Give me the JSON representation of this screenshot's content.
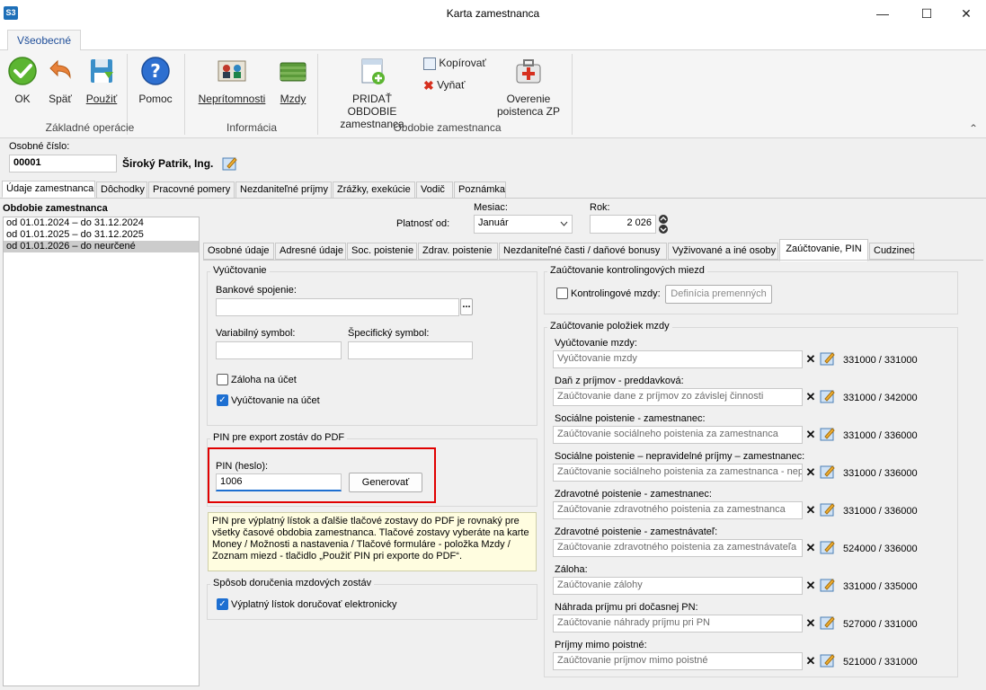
{
  "window": {
    "app_badge": "S3",
    "title": "Karta zamestnanca",
    "minimize": "—",
    "maximize": "☐",
    "close": "✕"
  },
  "ribbon": {
    "tab": "Všeobecné",
    "buttons": {
      "ok": "OK",
      "back": "Späť",
      "apply": "Použiť",
      "help": "Pomoc",
      "absence": "Neprítomnosti",
      "wages": "Mzdy",
      "add_period_1": "PRIDAŤ OBDOBIE",
      "add_period_2": "zamestnanca",
      "copy": "Kopírovať",
      "cut": "Vyňať",
      "verify_1": "Overenie",
      "verify_2": "poistenca ZP"
    },
    "groups": {
      "basic": "Základné operácie",
      "info": "Informácia",
      "period": "Obdobie zamestnanca"
    },
    "collapse": "⌃"
  },
  "employee": {
    "number_label": "Osobné číslo:",
    "number": "00001",
    "name": "Široký Patrik, Ing."
  },
  "main_tabs": [
    "Údaje zamestnanca",
    "Dôchodky",
    "Pracovné pomery",
    "Nezdaniteľné príjmy",
    "Zrážky, exekúcie",
    "Vodič",
    "Poznámka"
  ],
  "periods": {
    "title": "Obdobie zamestnanca",
    "items": [
      "od 01.01.2024 – do 31.12.2024",
      "od 01.01.2025 – do 31.12.2025",
      "od 01.01.2026 – do neurčené"
    ]
  },
  "validity": {
    "label": "Platnosť od:",
    "month_label": "Mesiac:",
    "month": "Január",
    "year_label": "Rok:",
    "year": "2 026"
  },
  "sub_tabs": [
    "Osobné údaje",
    "Adresné údaje",
    "Soc. poistenie",
    "Zdrav. poistenie",
    "Nezdaniteľné časti / daňové bonusy",
    "Vyživované a iné osoby",
    "Zaúčtovanie, PIN",
    "Cudzinec"
  ],
  "billing": {
    "title": "Vyúčtovanie",
    "bank_label": "Bankové spojenie:",
    "bank_btn": "...",
    "var_label": "Variabilný symbol:",
    "spec_label": "Špecifický symbol:",
    "advance_label": "Záloha na účet",
    "settle_label": "Vyúčtovanie na účet"
  },
  "pin": {
    "group_title": "PIN pre export zostáv do PDF",
    "label": "PIN (heslo):",
    "value": "1006",
    "generate": "Generovať",
    "info": "PIN pre výplatný lístok a ďalšie tlačové zostavy do PDF je rovnaký pre všetky časové obdobia zamestnanca. Tlačové zostavy vyberáte na karte Money / Možnosti a nastavenia / Tlačové formuláre - položka Mzdy / Zoznam miezd - tlačidlo „Použiť PIN pri exporte do PDF“."
  },
  "delivery": {
    "title": "Spôsob doručenia mzdových zostáv",
    "e_payslip": "Výplatný lístok doručovať elektronicky"
  },
  "control": {
    "title": "Zaúčtovanie kontrolingových miezd",
    "checkbox": "Kontrolingové mzdy:",
    "button": "Definícia premenných"
  },
  "accounting": {
    "title": "Zaúčtovanie položiek mzdy",
    "items": [
      {
        "label": "Vyúčtovanie mzdy:",
        "placeholder": "Vyúčtovanie mzdy",
        "accounts": "331000 / 331000"
      },
      {
        "label": "Daň z príjmov - preddavková:",
        "placeholder": "Zaúčtovanie dane z príjmov zo závislej činnosti",
        "accounts": "331000 / 342000"
      },
      {
        "label": "Sociálne poistenie - zamestnanec:",
        "placeholder": "Zaúčtovanie sociálneho poistenia za zamestnanca",
        "accounts": "331000 / 336000"
      },
      {
        "label": "Sociálne poistenie – nepravidelné príjmy – zamestnanec:",
        "placeholder": "Zaúčtovanie sociálneho poistenia za zamestnanca - nepra",
        "accounts": "331000 / 336000"
      },
      {
        "label": "Zdravotné poistenie - zamestnanec:",
        "placeholder": "Zaúčtovanie zdravotného poistenia za zamestnanca",
        "accounts": "331000 / 336000"
      },
      {
        "label": "Zdravotné poistenie - zamestnávateľ:",
        "placeholder": "Zaúčtovanie zdravotného poistenia za zamestnávateľa",
        "accounts": "524000 / 336000"
      },
      {
        "label": "Záloha:",
        "placeholder": "Zaúčtovanie zálohy",
        "accounts": "331000 / 335000"
      },
      {
        "label": "Náhrada príjmu pri dočasnej PN:",
        "placeholder": "Zaúčtovanie náhrady príjmu pri PN",
        "accounts": "527000 / 331000"
      },
      {
        "label": "Príjmy mimo poistné:",
        "placeholder": "Zaúčtovanie príjmov mimo poistné",
        "accounts": "521000 / 331000"
      }
    ],
    "clear_glyph": "✕"
  },
  "colors": {
    "accent": "#1d6fd1",
    "highlight": "#e00000",
    "info_bg": "#fffde0"
  }
}
